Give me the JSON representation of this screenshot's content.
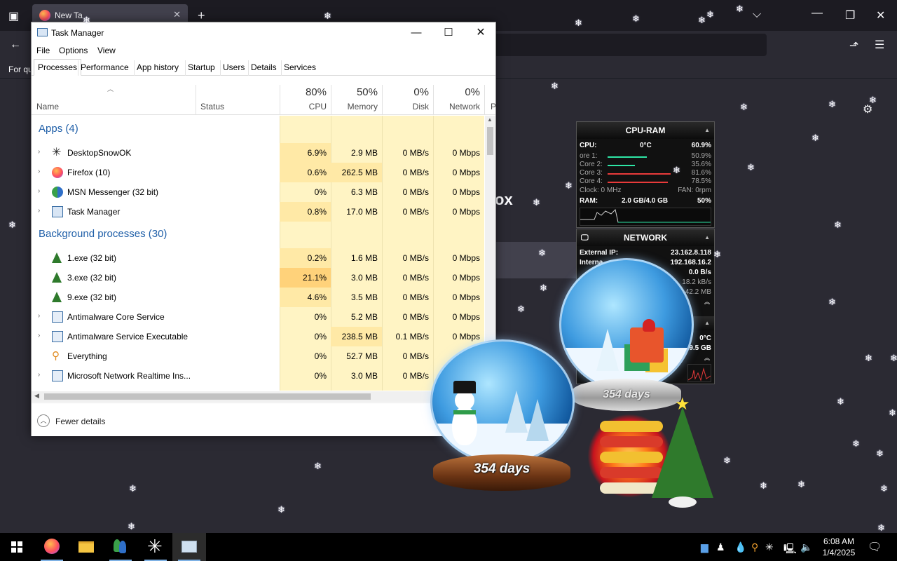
{
  "firefox": {
    "tab_label": "New Ta",
    "bookmark_text": "For qu",
    "logo_partial": "ox"
  },
  "taskmanager": {
    "title": "Task Manager",
    "menu": [
      "File",
      "Options",
      "View"
    ],
    "tabs": [
      "Processes",
      "Performance",
      "App history",
      "Startup",
      "Users",
      "Details",
      "Services"
    ],
    "active_tab": "Processes",
    "columns": {
      "name": "Name",
      "status": "Status",
      "cpu": {
        "pct": "80%",
        "label": "CPU"
      },
      "memory": {
        "pct": "50%",
        "label": "Memory"
      },
      "disk": {
        "pct": "0%",
        "label": "Disk"
      },
      "network": {
        "pct": "0%",
        "label": "Network"
      },
      "power_partial": "P"
    },
    "groups": {
      "apps": "Apps (4)",
      "background": "Background processes (30)"
    },
    "apps": [
      {
        "name": "DesktopSnowOK",
        "cpu": "6.9%",
        "mem": "2.9 MB",
        "disk": "0 MB/s",
        "net": "0 Mbps",
        "icon": "snowflake-icon",
        "expand": true
      },
      {
        "name": "Firefox (10)",
        "cpu": "0.6%",
        "mem": "262.5 MB",
        "disk": "0 MB/s",
        "net": "0 Mbps",
        "icon": "firefox-icon",
        "expand": true
      },
      {
        "name": "MSN Messenger (32 bit)",
        "cpu": "0%",
        "mem": "6.3 MB",
        "disk": "0 MB/s",
        "net": "0 Mbps",
        "icon": "messenger-icon",
        "expand": true
      },
      {
        "name": "Task Manager",
        "cpu": "0.8%",
        "mem": "17.0 MB",
        "disk": "0 MB/s",
        "net": "0 Mbps",
        "icon": "taskmanager-icon",
        "expand": true
      }
    ],
    "background": [
      {
        "name": "1.exe (32 bit)",
        "cpu": "0.2%",
        "mem": "1.6 MB",
        "disk": "0 MB/s",
        "net": "0 Mbps",
        "icon": "tree-icon",
        "expand": false
      },
      {
        "name": "3.exe (32 bit)",
        "cpu": "21.1%",
        "mem": "3.0 MB",
        "disk": "0 MB/s",
        "net": "0 Mbps",
        "icon": "tree-icon",
        "expand": false
      },
      {
        "name": "9.exe (32 bit)",
        "cpu": "4.6%",
        "mem": "3.5 MB",
        "disk": "0 MB/s",
        "net": "0 Mbps",
        "icon": "tree-icon",
        "expand": false
      },
      {
        "name": "Antimalware Core Service",
        "cpu": "0%",
        "mem": "5.2 MB",
        "disk": "0 MB/s",
        "net": "0 Mbps",
        "icon": "service-icon",
        "expand": true
      },
      {
        "name": "Antimalware Service Executable",
        "cpu": "0%",
        "mem": "238.5 MB",
        "disk": "0.1 MB/s",
        "net": "0 Mbps",
        "icon": "service-icon",
        "expand": true
      },
      {
        "name": "Everything",
        "cpu": "0%",
        "mem": "52.7 MB",
        "disk": "0 MB/s",
        "net": "0",
        "icon": "search-icon",
        "expand": false
      },
      {
        "name": "Microsoft Network Realtime Ins...",
        "cpu": "0%",
        "mem": "3.0 MB",
        "disk": "0 MB/s",
        "net": "",
        "icon": "service-icon",
        "expand": true
      }
    ],
    "fewer_details": "Fewer details"
  },
  "gadget_cpu": {
    "title": "CPU-RAM",
    "cpu_label": "CPU:",
    "cpu_temp": "0°C",
    "cpu_pct": "60.9%",
    "cores": [
      {
        "label": "ore 1:",
        "pct": "50.9%",
        "color": "#2ee6a6",
        "level": 0.509
      },
      {
        "label": "Core 2:",
        "pct": "35.6%",
        "color": "#2ee6a6",
        "level": 0.356
      },
      {
        "label": "Core 3:",
        "pct": "81.6%",
        "color": "#e83a3a",
        "level": 0.816
      },
      {
        "label": "Core 4:",
        "pct": "78.5%",
        "color": "#e83a3a",
        "level": 0.785
      }
    ],
    "clock": "Clock: 0 MHz",
    "fan": "FAN: 0rpm",
    "ram_label": "RAM:",
    "ram_value": "2.0 GB/4.0 GB",
    "ram_pct": "50%"
  },
  "gadget_net": {
    "title": "NETWORK",
    "external_label": "External IP:",
    "external_ip": "23.162.8.118",
    "internal_label": "Interna",
    "internal_ip": "192.168.16.2",
    "rate": "0.0 B/s",
    "up": "18.2 kB/s",
    "total": "42.2 MB"
  },
  "gadget_partial": {
    "temp": "0°C",
    "mem": "9.5 GB"
  },
  "globes": {
    "left_days": "354 days",
    "right_days": "354 days"
  },
  "taskbar": {
    "time": "6:08 AM",
    "date": "1/4/2025",
    "apps": [
      "start-icon",
      "firefox-icon",
      "file-explorer-icon",
      "messenger-icon",
      "snow-icon",
      "taskmanager-icon"
    ]
  }
}
